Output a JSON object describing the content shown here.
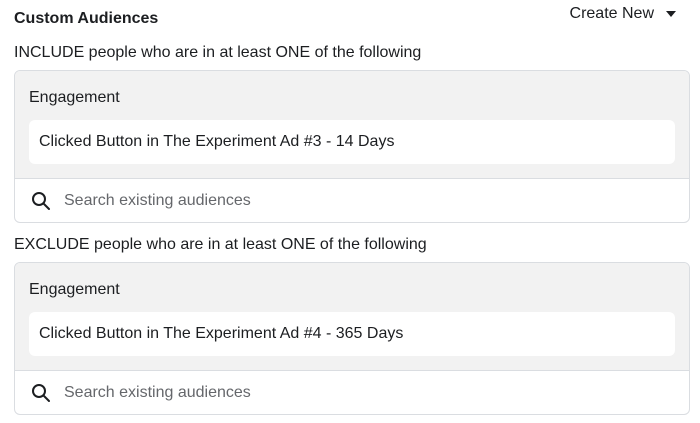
{
  "header": {
    "title": "Custom Audiences",
    "create_new_label": "Create New"
  },
  "include": {
    "label": "INCLUDE people who are in at least ONE of the following",
    "group_title": "Engagement",
    "audience": "Clicked Button in The Experiment Ad #3 - 14 Days",
    "search_placeholder": "Search existing audiences"
  },
  "exclude": {
    "label": "EXCLUDE people who are in at least ONE of the following",
    "group_title": "Engagement",
    "audience": "Clicked Button in The Experiment Ad #4 - 365 Days",
    "search_placeholder": "Search existing audiences"
  },
  "icons": {
    "search": "search-icon",
    "dropdown": "caret-down-icon"
  }
}
